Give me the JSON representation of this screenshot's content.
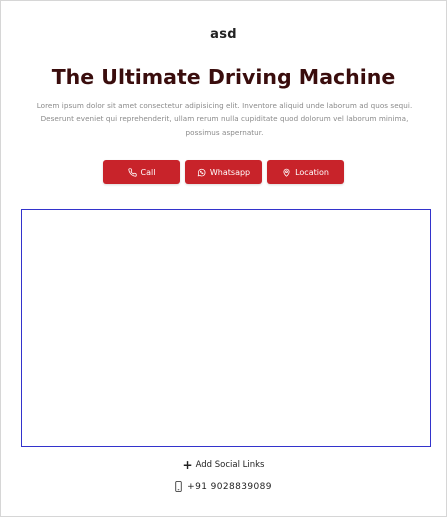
{
  "brand": {
    "name": "asd"
  },
  "hero": {
    "title": "The Ultimate Driving Machine",
    "description": "Lorem ipsum dolor sit amet consectetur adipisicing elit. Inventore aliquid unde laborum ad quos sequi. Deserunt eveniet qui reprehenderit, ullam rerum nulla cupiditate quod dolorum vel laborum minima, possimus aspernatur."
  },
  "actions": {
    "call_label": "Call",
    "whatsapp_label": "Whatsapp",
    "location_label": "Location",
    "button_color": "#c8232a"
  },
  "footer": {
    "add_social_label": "Add Social Links",
    "phone_number": "+91 9028839089"
  },
  "icons": {
    "call": "phone-icon",
    "whatsapp": "whatsapp-icon",
    "location": "map-pin-icon",
    "add": "plus-icon",
    "mobile": "mobile-phone-icon"
  }
}
